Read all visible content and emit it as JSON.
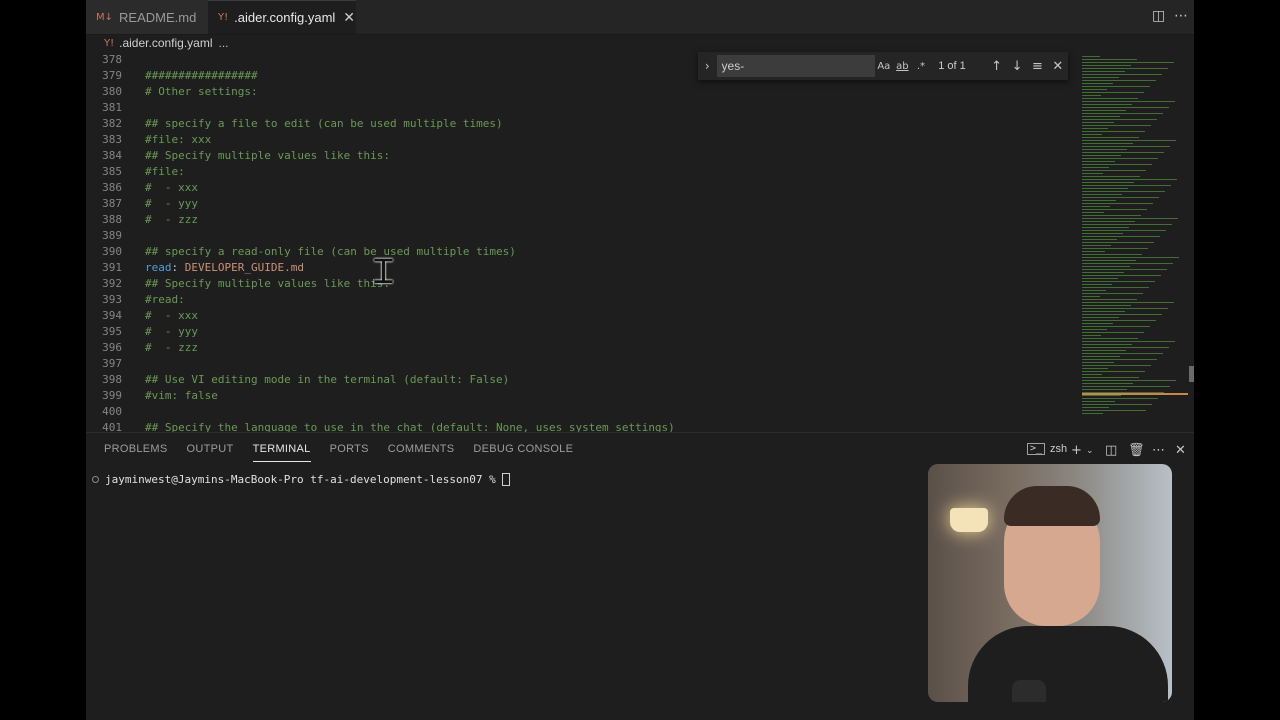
{
  "tabs": [
    {
      "label": "README.md",
      "icon": "markdown-icon"
    },
    {
      "label": ".aider.config.yaml",
      "icon": "yaml-icon"
    }
  ],
  "breadcrumb": {
    "file": ".aider.config.yaml",
    "more": "..."
  },
  "find": {
    "query": "yes-",
    "result": "1 of 1",
    "case_label": "Aa",
    "word_label": "ab",
    "regex_label": ".*"
  },
  "code_lines": [
    {
      "n": "378",
      "parts": []
    },
    {
      "n": "379",
      "parts": [
        {
          "t": "#################",
          "c": "comment"
        }
      ]
    },
    {
      "n": "380",
      "parts": [
        {
          "t": "# Other settings:",
          "c": "comment"
        }
      ]
    },
    {
      "n": "381",
      "parts": []
    },
    {
      "n": "382",
      "parts": [
        {
          "t": "## specify a file to edit (can be used multiple times)",
          "c": "comment"
        }
      ]
    },
    {
      "n": "383",
      "parts": [
        {
          "t": "#file: xxx",
          "c": "comment"
        }
      ]
    },
    {
      "n": "384",
      "parts": [
        {
          "t": "## Specify multiple values like this:",
          "c": "comment"
        }
      ]
    },
    {
      "n": "385",
      "parts": [
        {
          "t": "#file:",
          "c": "comment"
        }
      ]
    },
    {
      "n": "386",
      "parts": [
        {
          "t": "#  - xxx",
          "c": "comment"
        }
      ]
    },
    {
      "n": "387",
      "parts": [
        {
          "t": "#  - yyy",
          "c": "comment"
        }
      ]
    },
    {
      "n": "388",
      "parts": [
        {
          "t": "#  - zzz",
          "c": "comment"
        }
      ]
    },
    {
      "n": "389",
      "parts": []
    },
    {
      "n": "390",
      "parts": [
        {
          "t": "## specify a read-only file (can be used multiple times)",
          "c": "comment"
        }
      ]
    },
    {
      "n": "391",
      "parts": [
        {
          "t": "read",
          "c": "key"
        },
        {
          "t": ": ",
          "c": "plain"
        },
        {
          "t": "DEVELOPER_GUIDE.md",
          "c": "value"
        }
      ]
    },
    {
      "n": "392",
      "parts": [
        {
          "t": "## Specify multiple values like this:",
          "c": "comment"
        }
      ]
    },
    {
      "n": "393",
      "parts": [
        {
          "t": "#read:",
          "c": "comment"
        }
      ]
    },
    {
      "n": "394",
      "parts": [
        {
          "t": "#  - xxx",
          "c": "comment"
        }
      ]
    },
    {
      "n": "395",
      "parts": [
        {
          "t": "#  - yyy",
          "c": "comment"
        }
      ]
    },
    {
      "n": "396",
      "parts": [
        {
          "t": "#  - zzz",
          "c": "comment"
        }
      ]
    },
    {
      "n": "397",
      "parts": []
    },
    {
      "n": "398",
      "parts": [
        {
          "t": "## Use VI editing mode in the terminal (default: False)",
          "c": "comment"
        }
      ]
    },
    {
      "n": "399",
      "parts": [
        {
          "t": "#vim: false",
          "c": "comment"
        }
      ]
    },
    {
      "n": "400",
      "parts": []
    },
    {
      "n": "401",
      "parts": [
        {
          "t": "## Specify the language to use in the chat (default: None, uses system settings)",
          "c": "comment"
        }
      ]
    }
  ],
  "panel_tabs": [
    {
      "label": "PROBLEMS",
      "active": false
    },
    {
      "label": "OUTPUT",
      "active": false
    },
    {
      "label": "TERMINAL",
      "active": true
    },
    {
      "label": "PORTS",
      "active": false
    },
    {
      "label": "COMMENTS",
      "active": false
    },
    {
      "label": "DEBUG CONSOLE",
      "active": false
    }
  ],
  "terminal": {
    "shell": "zsh",
    "prompt": "jayminwest@Jaymins-MacBook-Pro tf-ai-development-lesson07 %"
  },
  "colors": {
    "comment": "#6a9955",
    "key": "#569cd6",
    "value": "#ce9178",
    "plain": "#cccccc",
    "background": "#1e1e1e"
  }
}
